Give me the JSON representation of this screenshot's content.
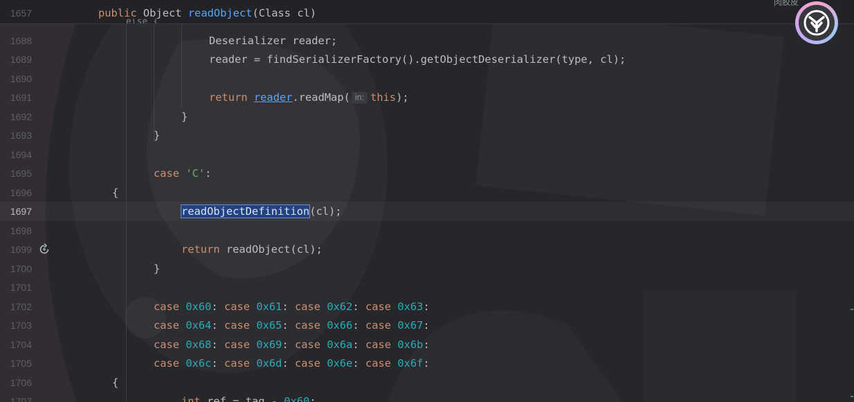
{
  "sticky": {
    "line": "1657",
    "kw": "public",
    "type": "Object",
    "method": "readObject",
    "params": "(Class cl)"
  },
  "header_overflow_text": "肉胶皮",
  "partial_top_line": "else {",
  "lines": {
    "l1688": {
      "num": "1688",
      "text": "Deserializer reader;"
    },
    "l1689": {
      "num": "1689",
      "text": "reader = findSerializerFactory().getObjectDeserializer(type, cl);"
    },
    "l1690": {
      "num": "1690"
    },
    "l1691": {
      "num": "1691",
      "kw": "return",
      "var": "reader",
      "mid": ".readMap(",
      "hint": "in:",
      "this": "this",
      "end": ");"
    },
    "l1692": {
      "num": "1692",
      "text": "}"
    },
    "l1693": {
      "num": "1693",
      "text": "}"
    },
    "l1694": {
      "num": "1694"
    },
    "l1695": {
      "num": "1695",
      "kw": "case",
      "str": "'C'",
      "end": ":"
    },
    "l1696": {
      "num": "1696",
      "text": "{"
    },
    "l1697": {
      "num": "1697",
      "sel": "readObjectDefinition",
      "end": "(cl);"
    },
    "l1698": {
      "num": "1698"
    },
    "l1699": {
      "num": "1699",
      "kw": "return",
      "end": "readObject(cl);"
    },
    "l1700": {
      "num": "1700",
      "text": "}"
    },
    "l1701": {
      "num": "1701"
    },
    "l1702": {
      "num": "1702",
      "cases": [
        "0x60",
        "0x61",
        "0x62",
        "0x63"
      ]
    },
    "l1703": {
      "num": "1703",
      "cases": [
        "0x64",
        "0x65",
        "0x66",
        "0x67"
      ]
    },
    "l1704": {
      "num": "1704",
      "cases": [
        "0x68",
        "0x69",
        "0x6a",
        "0x6b"
      ]
    },
    "l1705": {
      "num": "1705",
      "cases": [
        "0x6c",
        "0x6d",
        "0x6e",
        "0x6f"
      ]
    },
    "l1706": {
      "num": "1706",
      "text": "{"
    },
    "l1707": {
      "num": "1707",
      "kw": "int",
      "mid": "ref = tag - ",
      "numv": "0x60",
      "end": ";"
    }
  },
  "case_kw": "case",
  "colon": ":",
  "icons": {
    "gutter": "recursive-call-icon",
    "avatar": "plugin-logo-icon"
  },
  "colors": {
    "keyword": "#cf8e6d",
    "function": "#56a8f5",
    "string": "#6aab73",
    "number": "#2aacb8",
    "selection": "#214283"
  }
}
